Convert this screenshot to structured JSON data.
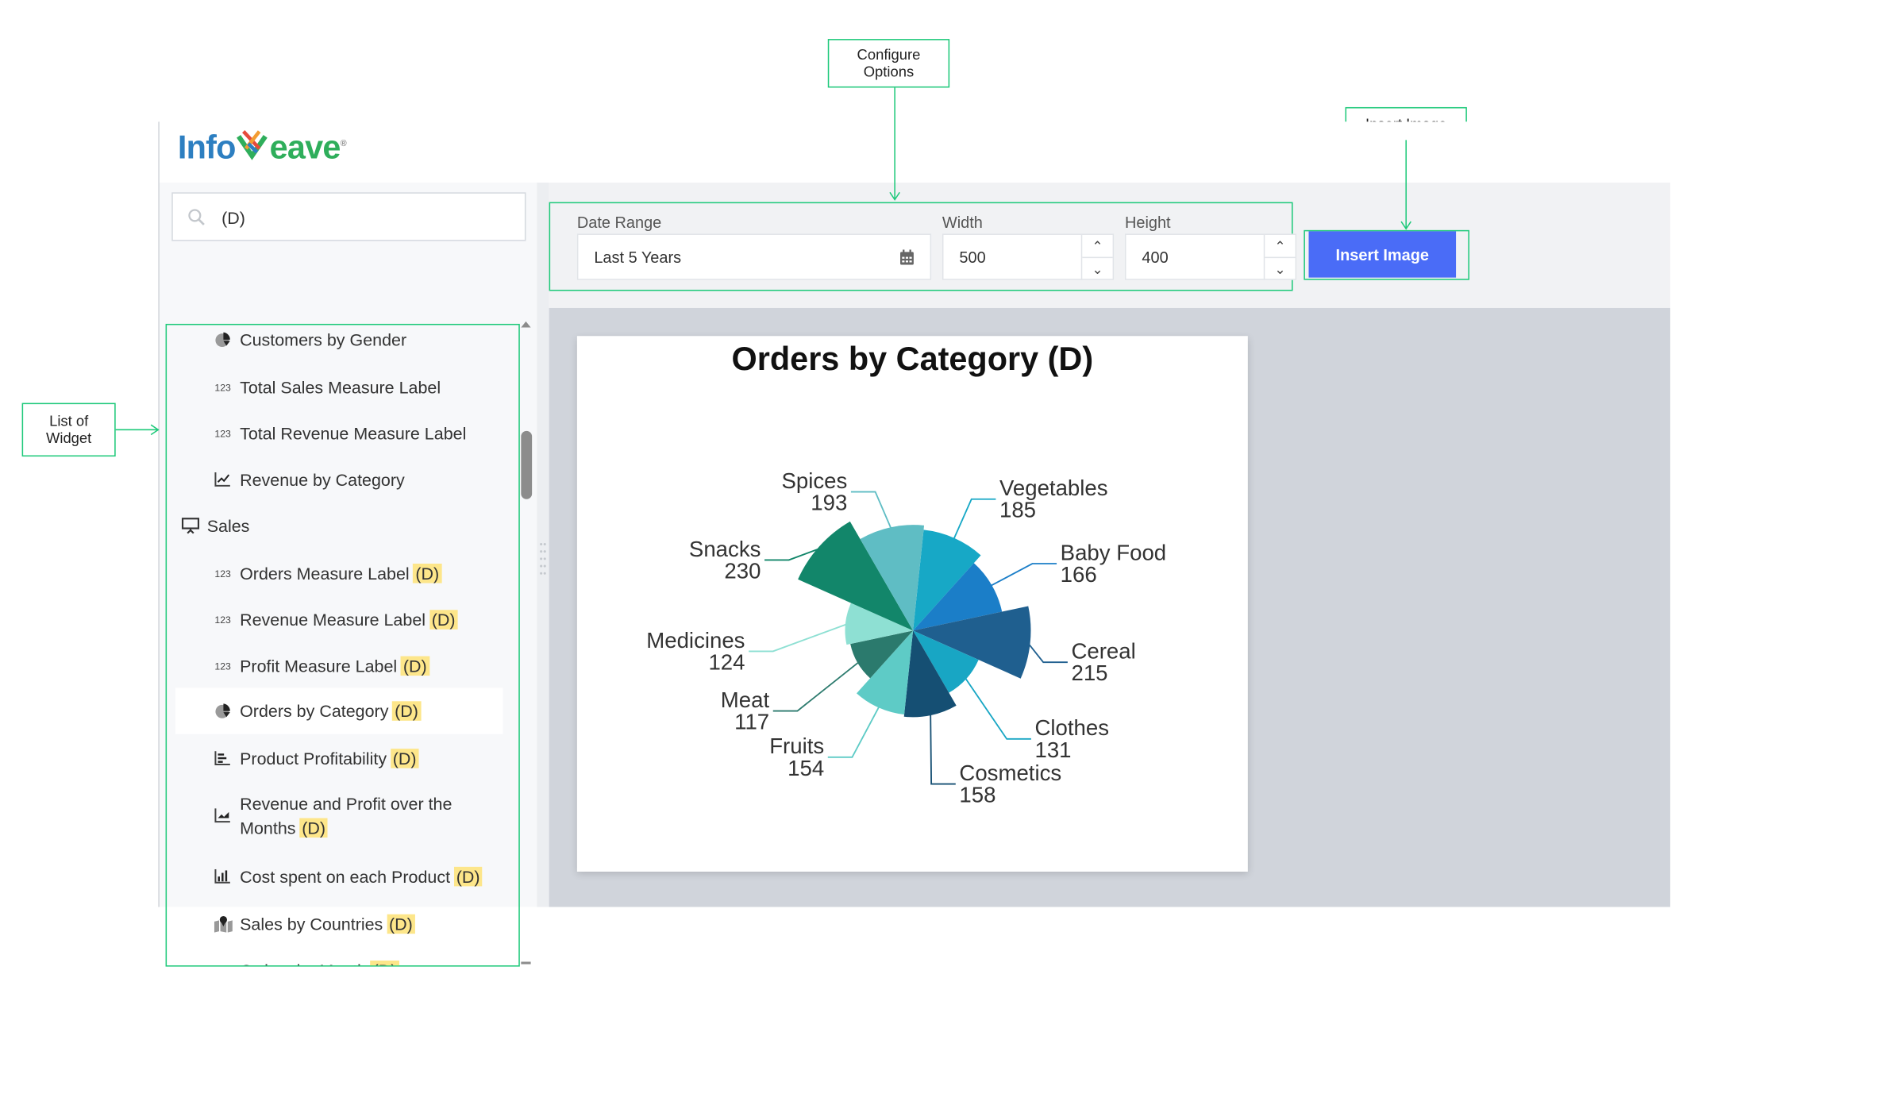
{
  "app": {
    "logo_text": "Infoweave",
    "logo_parts": {
      "left": "Info",
      "right": "eave"
    }
  },
  "sidebar": {
    "search": {
      "value": "(D)",
      "icon": "search-icon"
    },
    "items": [
      {
        "label": "Customers by Gender",
        "icon": "pie-chart-icon",
        "badge": "",
        "level": 2
      },
      {
        "label": "Total Sales Measure Label",
        "icon": "number-123-icon",
        "badge": "",
        "level": 2
      },
      {
        "label": "Total Revenue Measure Label",
        "icon": "number-123-icon",
        "badge": "",
        "level": 2
      },
      {
        "label": "Revenue by Category",
        "icon": "line-chart-icon",
        "badge": "",
        "level": 2
      },
      {
        "label": "Sales",
        "icon": "presentation-icon",
        "badge": "",
        "level": 1
      },
      {
        "label": "Orders Measure Label",
        "icon": "number-123-icon",
        "badge": "(D)",
        "level": 2
      },
      {
        "label": "Revenue Measure Label",
        "icon": "number-123-icon",
        "badge": "(D)",
        "level": 2
      },
      {
        "label": "Profit Measure Label",
        "icon": "number-123-icon",
        "badge": "(D)",
        "level": 2
      },
      {
        "label": "Orders by Category",
        "icon": "pie-chart-icon",
        "badge": "(D)",
        "level": 2,
        "selected": true
      },
      {
        "label": "Product Profitability",
        "icon": "bar-chart-icon",
        "badge": "(D)",
        "level": 2
      },
      {
        "label": "Revenue and Profit over the",
        "label2": "Months",
        "icon": "area-chart-icon",
        "badge": "(D)",
        "level": 2
      },
      {
        "label": "Cost spent on each Product",
        "icon": "column-chart-icon",
        "badge": "(D)",
        "level": 2
      },
      {
        "label": "Sales by Countries",
        "icon": "map-icon",
        "badge": "(D)",
        "level": 2
      },
      {
        "label": "Orders by Month",
        "icon": "calendar-icon",
        "badge": "(D)",
        "level": 2
      }
    ]
  },
  "config": {
    "date_range_label": "Date Range",
    "date_range_value": "Last 5 Years",
    "width_label": "Width",
    "width_value": "500",
    "height_label": "Height",
    "height_value": "400",
    "insert_button": "Insert Image"
  },
  "annotations": {
    "configure": [
      "Configure",
      "Options"
    ],
    "insert": "Insert Image",
    "list": [
      "List of",
      "Widget"
    ]
  },
  "colors": {
    "accent": "#4a6cf7",
    "highlight": "#fde68a",
    "annotation": "#1ec97a"
  },
  "chart_data": {
    "type": "pie",
    "variant": "polar-area",
    "title": "Orders by Category (D)",
    "categories": [
      "Vegetables",
      "Baby Food",
      "Cereal",
      "Clothes",
      "Cosmetics",
      "Fruits",
      "Meat",
      "Medicines",
      "Snacks",
      "Spices"
    ],
    "values": [
      185,
      166,
      215,
      131,
      158,
      154,
      117,
      124,
      230,
      193
    ],
    "colors": [
      "#17a8c6",
      "#1b7ec8",
      "#1f5f8f",
      "#18a6c4",
      "#154f73",
      "#5ecbc6",
      "#2b7a6d",
      "#8ee0d3",
      "#12866a",
      "#5fbdc4"
    ],
    "legend": "none",
    "data_labels": true
  }
}
